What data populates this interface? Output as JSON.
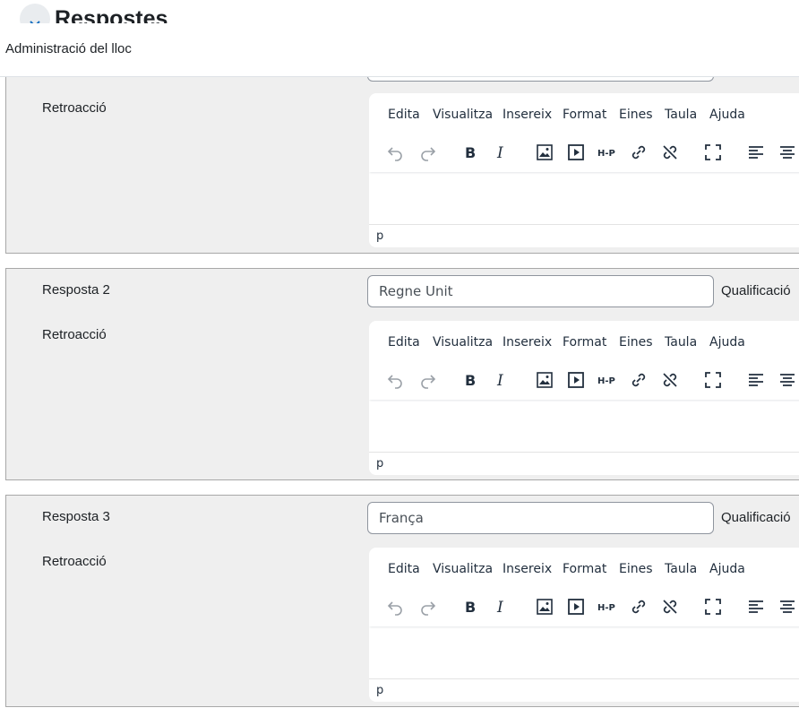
{
  "section": {
    "title": "Respostes"
  },
  "navbar": {
    "site_admin": "Administració del lloc"
  },
  "editor_menu": [
    "Edita",
    "Visualitza",
    "Insereix",
    "Format",
    "Eines",
    "Taula",
    "Ajuda"
  ],
  "editor_path": "p",
  "toolbar_icons": [
    "undo-icon",
    "redo-icon",
    "bold-icon",
    "italic-icon",
    "image-icon",
    "media-icon",
    "h5p-icon",
    "link-icon",
    "unlink-icon",
    "fullscreen-icon",
    "align-left-icon",
    "align-center-icon"
  ],
  "h5p_text": "H-P",
  "answers": [
    {
      "feedback_label": "Retroacció"
    },
    {
      "answer_label": "Resposta 2",
      "value": "Regne Unit",
      "grade_label": "Qualificació",
      "feedback_label": "Retroacció"
    },
    {
      "answer_label": "Resposta 3",
      "value": "França",
      "grade_label": "Qualificació",
      "feedback_label": "Retroacció"
    }
  ]
}
